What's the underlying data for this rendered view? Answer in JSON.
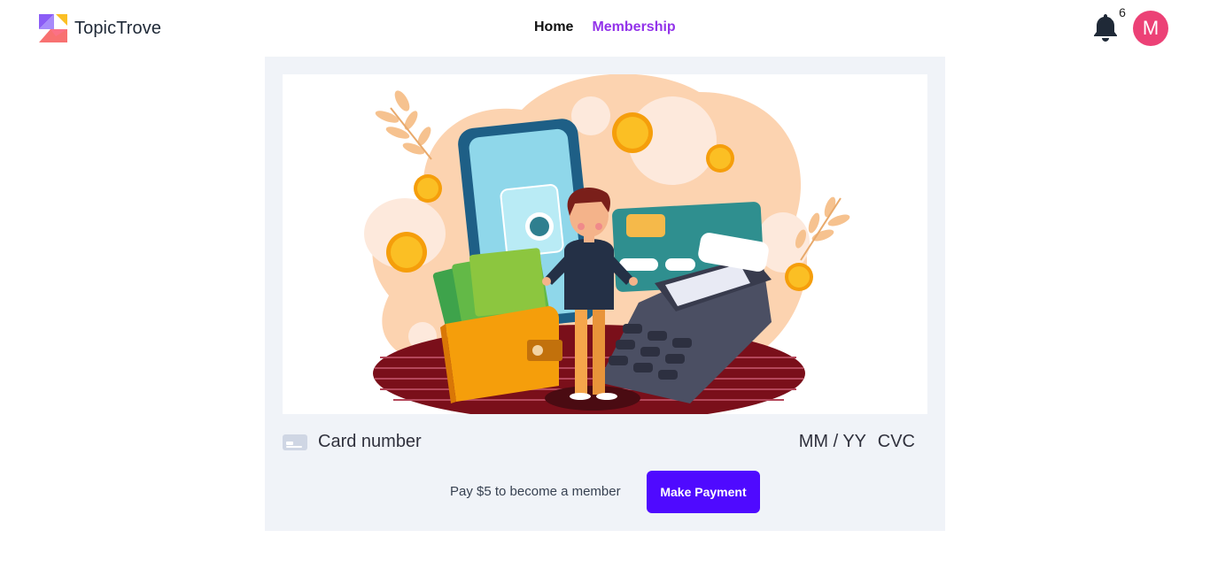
{
  "header": {
    "brand_name": "TopicTrove",
    "nav": {
      "home": "Home",
      "membership": "Membership"
    },
    "notifications_count": "6",
    "avatar_initial": "M"
  },
  "payment": {
    "card_number_placeholder": "Card number",
    "expiry_placeholder": "MM / YY",
    "cvc_placeholder": "CVC",
    "pay_text": "Pay $5 to become a member",
    "pay_button_label": "Make Payment"
  },
  "colors": {
    "brand_purple": "#9333ea",
    "pay_button": "#4f0aff",
    "avatar_bg": "#ec4176",
    "panel_bg": "#f0f3f8"
  },
  "icons": {
    "brand": "topictrove-logo-icon",
    "notifications": "bell-icon",
    "card": "credit-card-icon"
  }
}
